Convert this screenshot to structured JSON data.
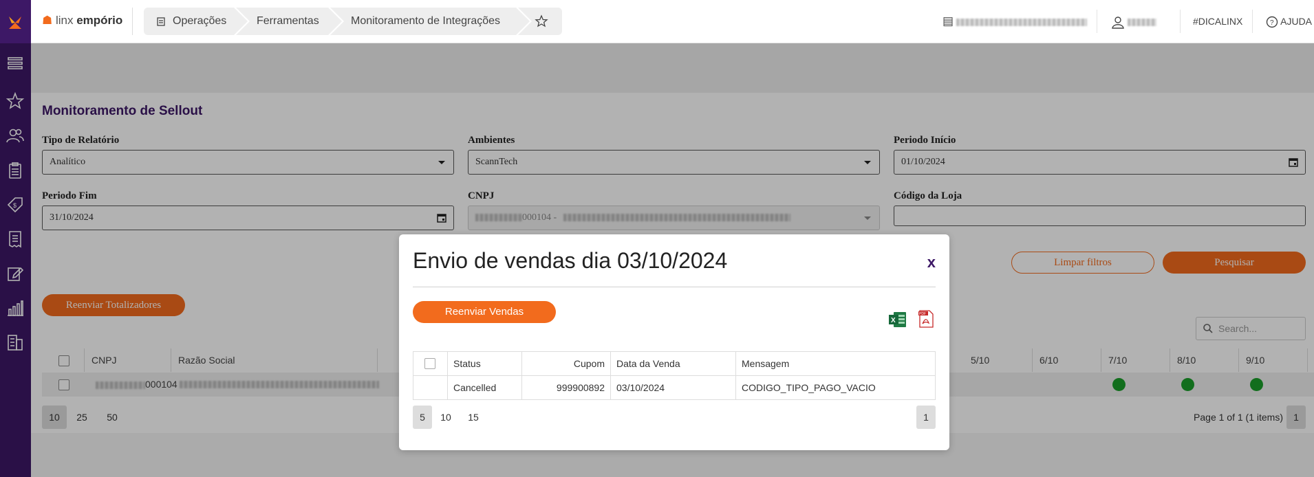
{
  "app": {
    "brand_light": "linx ",
    "brand_bold": "empório",
    "accent_color": "#f26b1d",
    "primary_color": "#3d1866"
  },
  "breadcrumb": [
    {
      "label": "Operações"
    },
    {
      "label": "Ferramentas"
    },
    {
      "label": "Monitoramento de Integrações"
    }
  ],
  "header": {
    "hashtag": "#DICALINX",
    "help": "AJUDA"
  },
  "page": {
    "title": "Monitoramento de Sellout",
    "filters": {
      "tipo_label": "Tipo de Relatório",
      "tipo_value": "Analítico",
      "ambientes_label": "Ambientes",
      "ambientes_value": "ScannTech",
      "inicio_label": "Periodo Início",
      "inicio_value": "01/10/2024",
      "fim_label": "Periodo Fim",
      "fim_value": "31/10/2024",
      "cnpj_label": "CNPJ",
      "cnpj_value_suffix": "000104 -",
      "loja_label": "Código da Loja",
      "loja_value": ""
    },
    "clear_button": "Limpar filtros",
    "search_button": "Pesquisar",
    "resend_totals_button": "Reenviar Totalizadores",
    "search_placeholder": "Search...",
    "table": {
      "columns": [
        "CNPJ",
        "Razão Social",
        "5/10",
        "6/10",
        "7/10",
        "8/10",
        "9/10"
      ],
      "row_cnpj_suffix": "000104"
    },
    "page_sizes": [
      "10",
      "25",
      "50"
    ],
    "page_info": "Page 1 of 1 (1 items)",
    "current_page": "1"
  },
  "modal": {
    "title": "Envio de vendas dia 03/10/2024",
    "close": "x",
    "resend_button": "Reenviar Vendas",
    "columns": [
      "Status",
      "Cupom",
      "Data da Venda",
      "Mensagem"
    ],
    "rows": [
      {
        "status": "Cancelled",
        "cupom": "999900892",
        "data": "03/10/2024",
        "mensagem": "CODIGO_TIPO_PAGO_VACIO"
      }
    ],
    "page_sizes": [
      "5",
      "10",
      "15"
    ],
    "current_page": "1"
  }
}
